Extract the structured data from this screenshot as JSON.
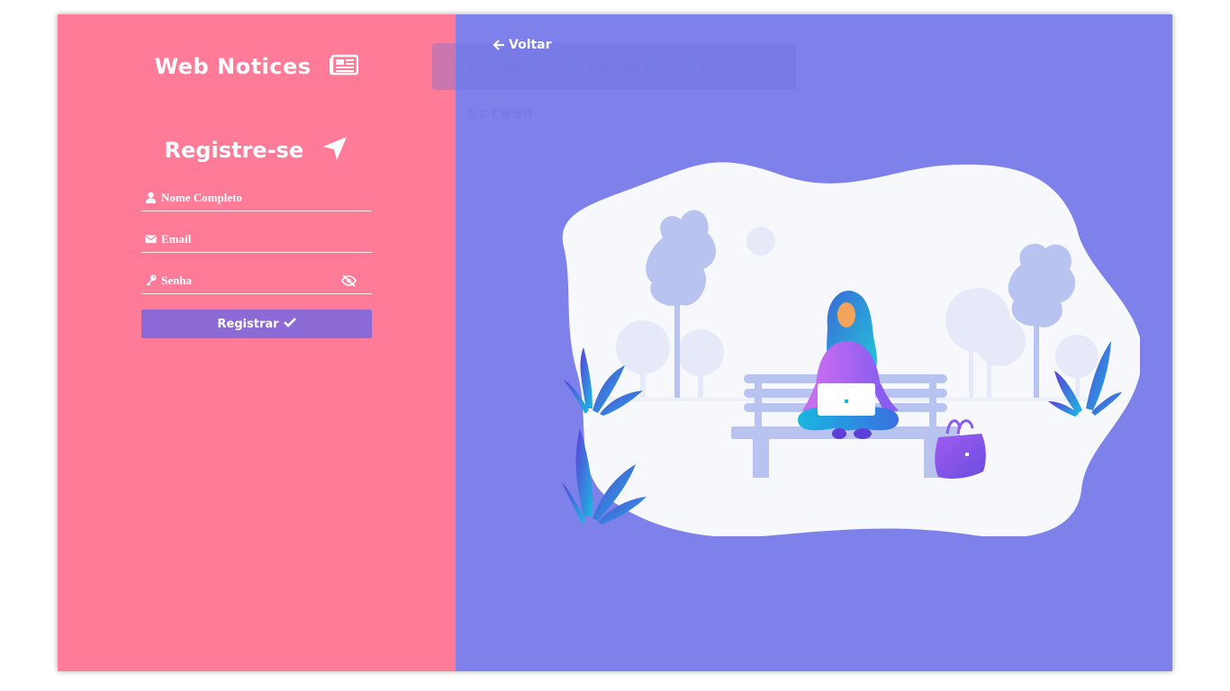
{
  "brand": {
    "title": "Web Notices",
    "icon": "newspaper-icon"
  },
  "register": {
    "title": "Registre-se",
    "icon": "paper-plane-icon"
  },
  "form": {
    "name_placeholder": "Nome Completo",
    "email_placeholder": "Email",
    "password_placeholder": "Senha",
    "submit_label": "Registrar"
  },
  "nav": {
    "back_label": "Voltar"
  },
  "overlay": {
    "fullscreen_hint_pre": "Press",
    "fullscreen_hint_key": "F11",
    "fullscreen_hint_post": "to exit full screen"
  },
  "colors": {
    "left_panel": "#ff7b98",
    "right_panel": "#7e81ea",
    "button": "#8c6ad5"
  }
}
